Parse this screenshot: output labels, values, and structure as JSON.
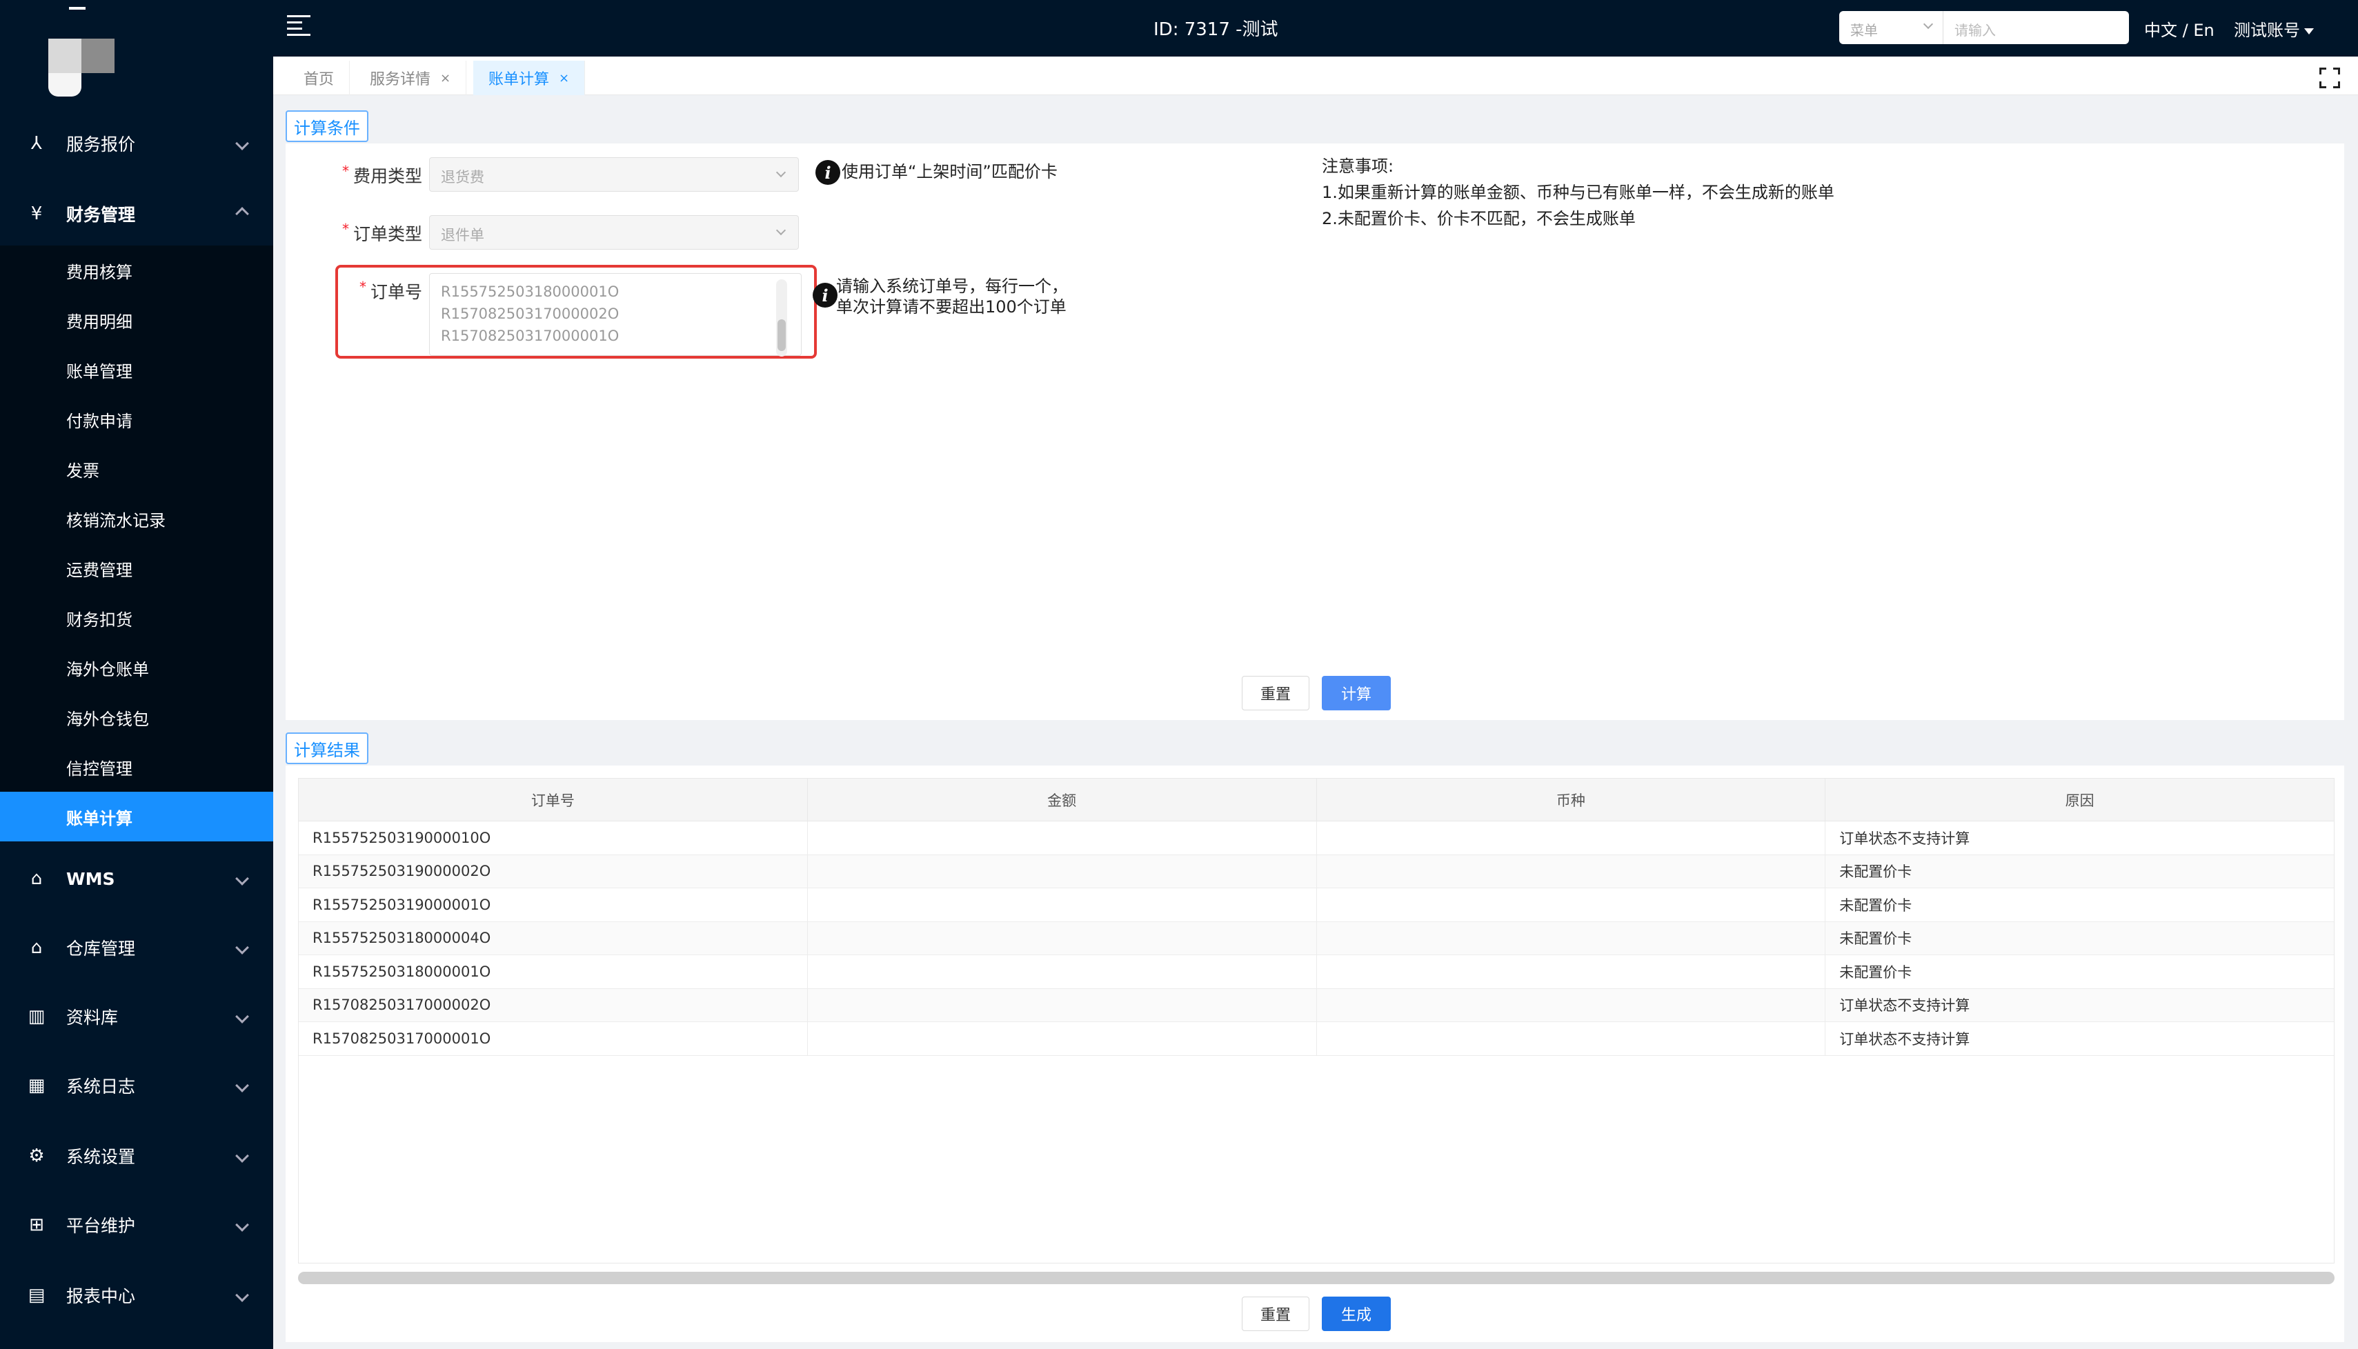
{
  "sidebar": {
    "groups": [
      {
        "label": "服务报价",
        "icon": "share-nodes-icon",
        "glyph": "⅄"
      },
      {
        "label": "财务管理",
        "icon": "yuan-circle-icon",
        "glyph": "¥"
      },
      {
        "label": "WMS",
        "icon": "warehouse-home-icon",
        "glyph": "⌂"
      },
      {
        "label": "仓库管理",
        "icon": "building-icon",
        "glyph": "⌂"
      },
      {
        "label": "资料库",
        "icon": "database-grid-icon",
        "glyph": "▥"
      },
      {
        "label": "系统日志",
        "icon": "calendar-log-icon",
        "glyph": "▦"
      },
      {
        "label": "系统设置",
        "icon": "settings-gear-icon",
        "glyph": "⚙"
      },
      {
        "label": "平台维护",
        "icon": "apps-grid-icon",
        "glyph": "⊞"
      },
      {
        "label": "报表中心",
        "icon": "bar-chart-icon",
        "glyph": "▤"
      }
    ],
    "finance_items": [
      "费用核算",
      "费用明细",
      "账单管理",
      "付款申请",
      "发票",
      "核销流水记录",
      "运费管理",
      "财务扣货",
      "海外仓账单",
      "海外仓钱包",
      "信控管理",
      "账单计算"
    ],
    "active_item": "账单计算"
  },
  "topbar": {
    "title": "ID: 7317 -测试",
    "search_select": "菜单",
    "search_placeholder": "请输入",
    "language": "中文 / En",
    "account": "测试账号"
  },
  "tabs": [
    {
      "label": "首页",
      "closable": false
    },
    {
      "label": "服务详情",
      "closable": true
    },
    {
      "label": "账单计算",
      "closable": true,
      "active": true
    }
  ],
  "tab_close_glyph": "×",
  "conditions": {
    "section_title": "计算条件",
    "fee_type_label": "费用类型",
    "fee_type_value": "退货费",
    "order_type_label": "订单类型",
    "order_type_value": "退件单",
    "order_no_label": "订单号",
    "order_numbers": [
      "R15575250318000001O",
      "R15708250317000002O",
      "R15708250317000001O"
    ],
    "tip_match": "使用订单“上架时间”匹配价卡",
    "tip_input_line1": "请输入系统订单号，每行一个，",
    "tip_input_line2": "单次计算请不要超出100个订单",
    "notes_title": "注意事项:",
    "note_1": "1.如果重新计算的账单金额、币种与已有账单一样，不会生成新的账单",
    "note_2": "2.未配置价卡、价卡不匹配，不会生成账单",
    "reset_label": "重置",
    "calculate_label": "计算"
  },
  "results": {
    "section_title": "计算结果",
    "columns": [
      "订单号",
      "金额",
      "币种",
      "原因"
    ],
    "rows": [
      {
        "order": "R15575250319000010O",
        "amount": "",
        "currency": "",
        "reason": "订单状态不支持计算"
      },
      {
        "order": "R15575250319000002O",
        "amount": "",
        "currency": "",
        "reason": "未配置价卡"
      },
      {
        "order": "R15575250319000001O",
        "amount": "",
        "currency": "",
        "reason": "未配置价卡"
      },
      {
        "order": "R15575250318000004O",
        "amount": "",
        "currency": "",
        "reason": "未配置价卡"
      },
      {
        "order": "R15575250318000001O",
        "amount": "",
        "currency": "",
        "reason": "未配置价卡"
      },
      {
        "order": "R15708250317000002O",
        "amount": "",
        "currency": "",
        "reason": "订单状态不支持计算"
      },
      {
        "order": "R15708250317000001O",
        "amount": "",
        "currency": "",
        "reason": "订单状态不支持计算"
      }
    ],
    "reset_label": "重置",
    "generate_label": "生成"
  },
  "colors": {
    "sidebar_bg": "#001529",
    "accent": "#1890ff",
    "highlight": "#e53935"
  }
}
